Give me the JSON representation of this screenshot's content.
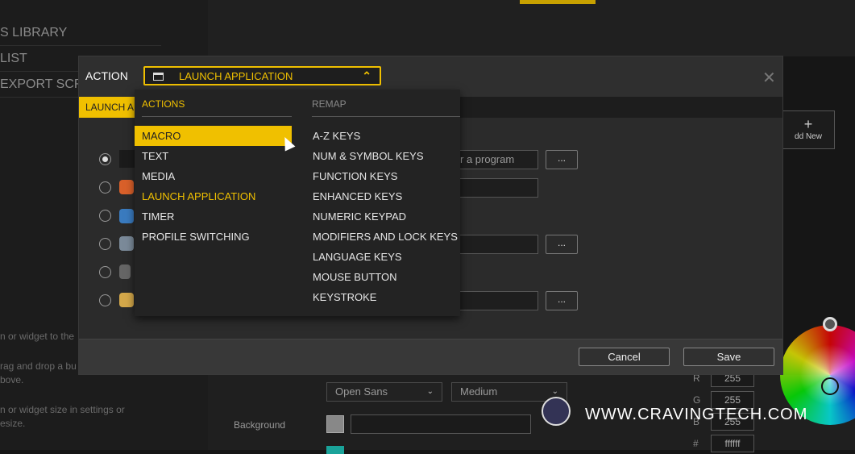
{
  "background": {
    "library_items": [
      "S LIBRARY",
      "LIST",
      "EXPORT SCR"
    ],
    "hints": [
      "n or widget to the",
      "rag and drop a bu",
      "bove.",
      "n or widget size in settings or",
      "esize."
    ],
    "font_select": "Open Sans",
    "weight_select": "Medium",
    "background_label": "Background",
    "rgb": [
      {
        "label": "R",
        "value": "255"
      },
      {
        "label": "G",
        "value": "255"
      },
      {
        "label": "B",
        "value": "255"
      },
      {
        "label": "#",
        "value": "ffffff"
      }
    ],
    "add_new_label": "dd New",
    "watermark": "WWW.CRAVINGTECH.COM"
  },
  "dialog": {
    "action_label": "ACTION",
    "action_value": "LAUNCH APPLICATION",
    "sub_tab": "LAUNCH A",
    "program_placeholder": "r a program",
    "browse_label": "...",
    "cancel_label": "Cancel",
    "save_label": "Save",
    "close_glyph": "✕"
  },
  "dropdown": {
    "actions_header": "ACTIONS",
    "remap_header": "REMAP",
    "actions": [
      "MACRO",
      "TEXT",
      "MEDIA",
      "LAUNCH APPLICATION",
      "TIMER",
      "PROFILE SWITCHING"
    ],
    "remap": [
      "A-Z KEYS",
      "NUM & SYMBOL KEYS",
      "FUNCTION KEYS",
      "ENHANCED KEYS",
      "NUMERIC KEYPAD",
      "MODIFIERS AND LOCK KEYS",
      "LANGUAGE KEYS",
      "MOUSE BUTTON",
      "KEYSTROKE"
    ],
    "highlighted": "MACRO",
    "selected": "LAUNCH APPLICATION"
  },
  "colors": {
    "accent": "#f0c000",
    "dialog_bg": "#2b2b2b"
  }
}
